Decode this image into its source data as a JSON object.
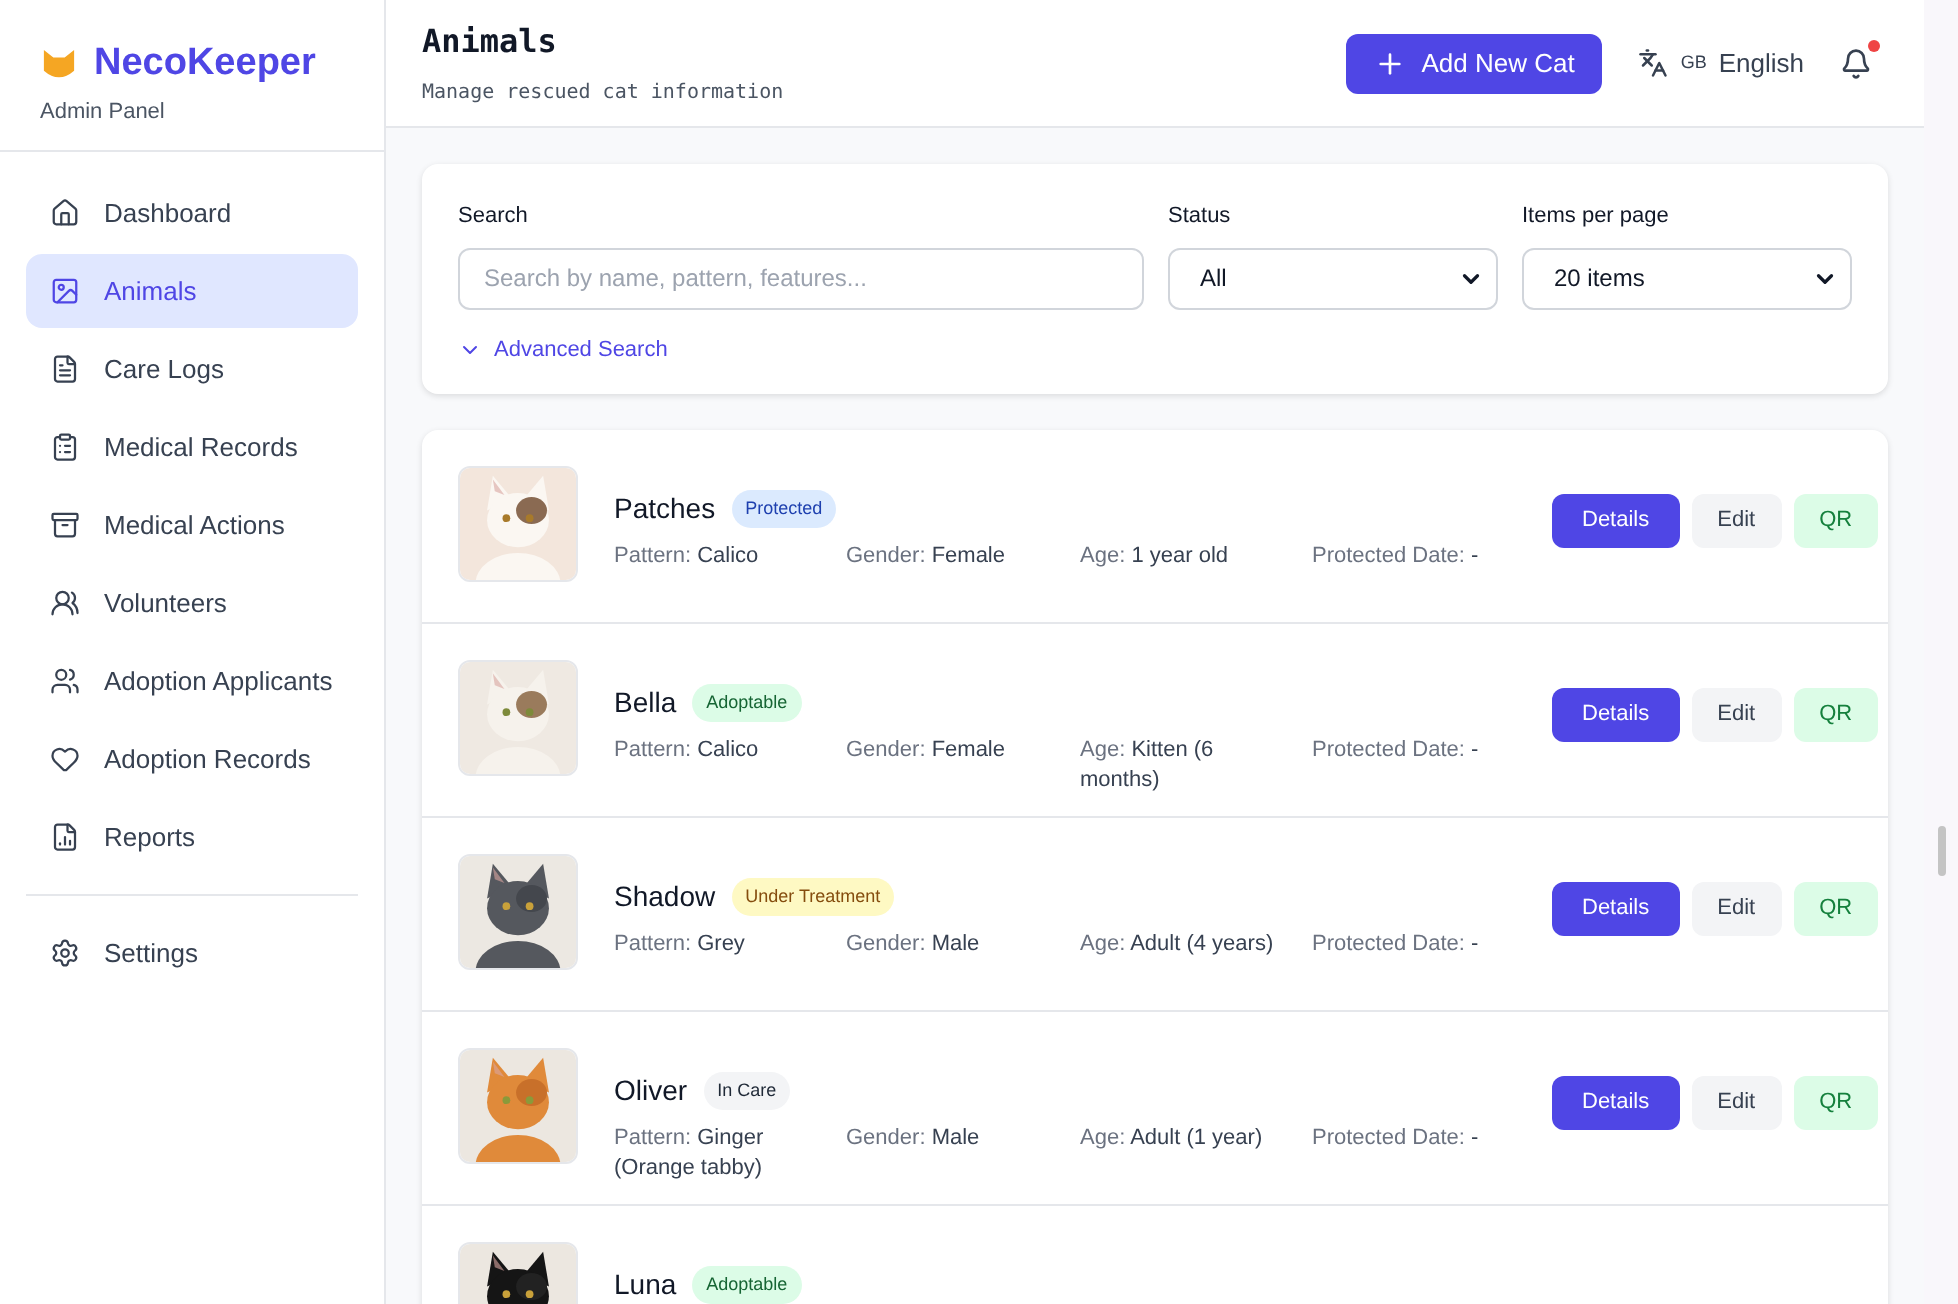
{
  "brand": {
    "name": "NecoKeeper",
    "subtitle": "Admin Panel"
  },
  "sidebar": {
    "items": [
      {
        "label": "Dashboard",
        "selected": false
      },
      {
        "label": "Animals",
        "selected": true
      },
      {
        "label": "Care Logs",
        "selected": false
      },
      {
        "label": "Medical Records",
        "selected": false
      },
      {
        "label": "Medical Actions",
        "selected": false
      },
      {
        "label": "Volunteers",
        "selected": false
      },
      {
        "label": "Adoption Applicants",
        "selected": false
      },
      {
        "label": "Adoption Records",
        "selected": false
      },
      {
        "label": "Reports",
        "selected": false
      }
    ],
    "bottom_items": [
      {
        "label": "Settings",
        "selected": false
      }
    ]
  },
  "header": {
    "title": "Animals",
    "subtitle": "Manage rescued cat information",
    "add_button": "Add New Cat",
    "language": {
      "flag": "GB",
      "label": "English"
    },
    "notifications": {
      "unread": true
    }
  },
  "filters": {
    "search": {
      "label": "Search",
      "placeholder": "Search by name, pattern, features..."
    },
    "status": {
      "label": "Status",
      "value": "All"
    },
    "per_page": {
      "label": "Items per page",
      "value": "20 items"
    },
    "advanced": "Advanced Search"
  },
  "cats": [
    {
      "name": "Patches",
      "status": {
        "label": "Protected",
        "kind": "protected"
      },
      "fields": [
        {
          "label": "Pattern:",
          "value": "Calico"
        },
        {
          "label": "Gender:",
          "value": "Female"
        },
        {
          "label": "Age:",
          "value": "1 year old"
        },
        {
          "label": "Protected Date:",
          "value": "-"
        }
      ],
      "actions": [
        "Details",
        "Edit",
        "QR"
      ]
    },
    {
      "name": "Bella",
      "status": {
        "label": "Adoptable",
        "kind": "adoptable"
      },
      "fields": [
        {
          "label": "Pattern:",
          "value": "Calico"
        },
        {
          "label": "Gender:",
          "value": "Female"
        },
        {
          "label": "Age:",
          "value": "Kitten (6 months)"
        },
        {
          "label": "Protected Date:",
          "value": "-"
        }
      ],
      "actions": [
        "Details",
        "Edit",
        "QR"
      ]
    },
    {
      "name": "Shadow",
      "status": {
        "label": "Under Treatment",
        "kind": "treatment"
      },
      "fields": [
        {
          "label": "Pattern:",
          "value": "Grey"
        },
        {
          "label": "Gender:",
          "value": "Male"
        },
        {
          "label": "Age:",
          "value": "Adult (4 years)"
        },
        {
          "label": "Protected Date:",
          "value": "-"
        }
      ],
      "actions": [
        "Details",
        "Edit",
        "QR"
      ]
    },
    {
      "name": "Oliver",
      "status": {
        "label": "In Care",
        "kind": "care"
      },
      "fields": [
        {
          "label": "Pattern:",
          "value": "Ginger (Orange tabby)"
        },
        {
          "label": "Gender:",
          "value": "Male"
        },
        {
          "label": "Age:",
          "value": "Adult (1 year)"
        },
        {
          "label": "Protected Date:",
          "value": "-"
        }
      ],
      "actions": [
        "Details",
        "Edit",
        "QR"
      ]
    },
    {
      "name": "Luna",
      "status": {
        "label": "Adoptable",
        "kind": "adoptable"
      }
    }
  ]
}
